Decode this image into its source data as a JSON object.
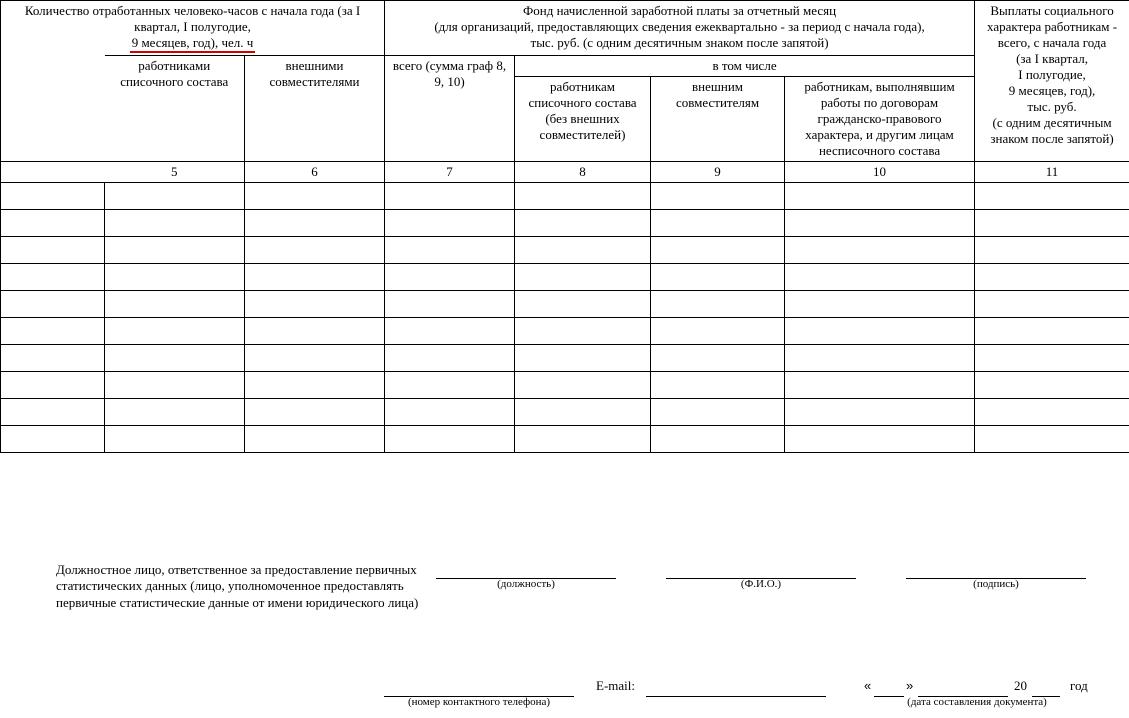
{
  "header": {
    "col_hours": "Количество отработанных человеко-часов с начала года (за I квартал, I полугодие,",
    "col_hours_last": "9 месяцев, год), чел. ч",
    "col_hours_sub1": "работниками списочного состава",
    "col_hours_sub2": "внешними совместителями",
    "col_fund": "Фонд начисленной заработной платы за отчетный месяц\n(для организаций, предоставляющих сведения ежеквартально - за период с начала года),\nтыс. руб. (с одним десятичным знаком после запятой)",
    "col_fund_total": "всего (сумма граф 8, 9, 10)",
    "col_fund_incl": "в том числе",
    "col_fund_s1": "работникам списочного состава (без внешних совместителей)",
    "col_fund_s2": "внешним совместителям",
    "col_fund_s3": "работникам, выполнявшим работы по договорам гражданско-правового характера, и другим лицам несписочного состава",
    "col_social": "Выплаты социального характера работникам - всего, с начала года\n(за I квартал,\nI полугодие,\n9 месяцев, год),\nтыс. руб.\n(с одним десятичным знаком после запятой)"
  },
  "nums": {
    "c5": "5",
    "c6": "6",
    "c7": "7",
    "c8": "8",
    "c9": "9",
    "c10": "10",
    "c11": "11"
  },
  "sig": {
    "lead": "Должностное лицо, ответственное за предоставление первичных статистических данных (лицо, уполномоченное предоставлять первичные статистические данные от имени юридического лица)",
    "post": "(должность)",
    "fio": "(Ф.И.О.)",
    "signature": "(подпись)",
    "phone": "(номер контактного телефона)",
    "email": "E-mail:",
    "q1": "«",
    "q2": "»",
    "y20": "20",
    "year": "год",
    "date": "(дата составления документа)"
  }
}
